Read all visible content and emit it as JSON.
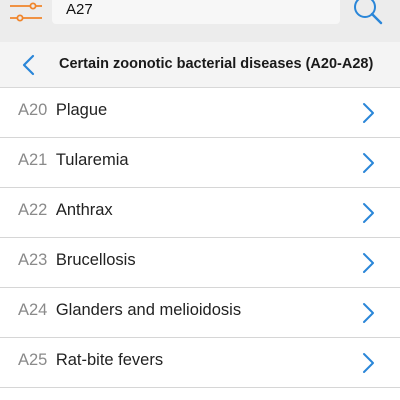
{
  "search": {
    "value": "A27"
  },
  "header": {
    "title": "Certain zoonotic bacterial diseases (A20-A28)"
  },
  "items": [
    {
      "code": "A20",
      "name": "Plague"
    },
    {
      "code": "A21",
      "name": "Tularemia"
    },
    {
      "code": "A22",
      "name": "Anthrax"
    },
    {
      "code": "A23",
      "name": "Brucellosis"
    },
    {
      "code": "A24",
      "name": "Glanders and melioidosis"
    },
    {
      "code": "A25",
      "name": "Rat-bite fevers"
    }
  ],
  "colors": {
    "accent_orange": "#f0852b",
    "accent_blue": "#2a86d8"
  },
  "icons": {
    "filter": "sliders-icon",
    "search": "search-icon",
    "back": "chevron-left-icon",
    "item": "chevron-right-icon"
  }
}
